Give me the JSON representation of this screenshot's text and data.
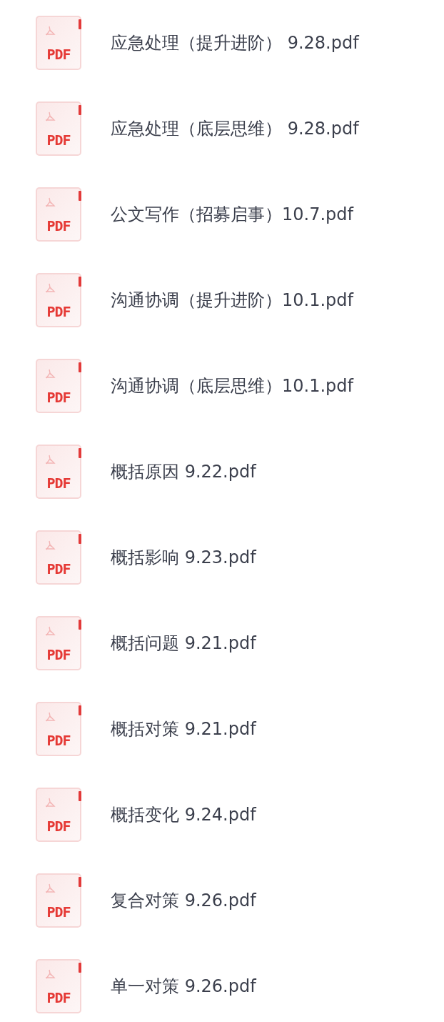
{
  "files": [
    {
      "name": "应急处理（提升进阶） 9.28.pdf",
      "type_label": "PDF"
    },
    {
      "name": "应急处理（底层思维） 9.28.pdf",
      "type_label": "PDF"
    },
    {
      "name": "公文写作（招募启事）10.7.pdf",
      "type_label": "PDF"
    },
    {
      "name": "沟通协调（提升进阶）10.1.pdf",
      "type_label": "PDF"
    },
    {
      "name": "沟通协调（底层思维）10.1.pdf",
      "type_label": "PDF"
    },
    {
      "name": "概括原因 9.22.pdf",
      "type_label": "PDF"
    },
    {
      "name": "概括影响 9.23.pdf",
      "type_label": "PDF"
    },
    {
      "name": "概括问题 9.21.pdf",
      "type_label": "PDF"
    },
    {
      "name": "概括对策 9.21.pdf",
      "type_label": "PDF"
    },
    {
      "name": "概括变化 9.24.pdf",
      "type_label": "PDF"
    },
    {
      "name": "复合对策 9.26.pdf",
      "type_label": "PDF"
    },
    {
      "name": "单一对策 9.26.pdf",
      "type_label": "PDF"
    }
  ]
}
